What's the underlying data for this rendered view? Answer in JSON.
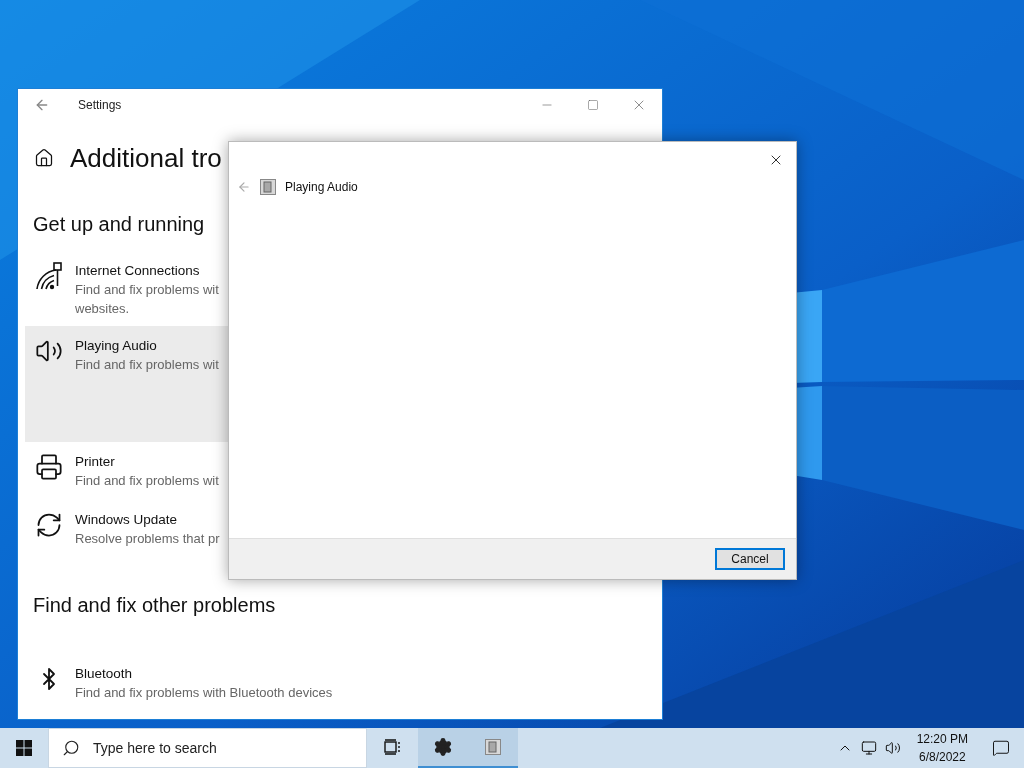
{
  "settings_window": {
    "title": "Settings",
    "heading": "Additional tro",
    "sections": [
      {
        "title": "Get up and running",
        "items": [
          {
            "kind": "internet",
            "name": "Internet Connections",
            "description_lines": [
              "Find and fix problems wit",
              "websites."
            ],
            "selected": false
          },
          {
            "kind": "audio",
            "name": "Playing Audio",
            "description_lines": [
              "Find and fix problems wit"
            ],
            "selected": true
          },
          {
            "kind": "printer",
            "name": "Printer",
            "description_lines": [
              "Find and fix problems wit"
            ],
            "selected": false
          },
          {
            "kind": "update",
            "name": "Windows Update",
            "description_lines": [
              "Resolve problems that pr"
            ],
            "selected": false
          }
        ]
      },
      {
        "title": "Find and fix other problems",
        "items": [
          {
            "kind": "bluetooth",
            "name": "Bluetooth",
            "description_lines": [
              "Find and fix problems with Bluetooth devices"
            ],
            "selected": false
          }
        ]
      }
    ]
  },
  "dialog": {
    "title": "Playing Audio",
    "buttons": [
      {
        "label": "Cancel",
        "default": true
      }
    ]
  },
  "taskbar": {
    "search": {
      "placeholder": "Type here to search"
    },
    "apps": [
      {
        "kind": "task-view",
        "active": false
      },
      {
        "kind": "settings",
        "active": true
      },
      {
        "kind": "troubleshooter",
        "active": true
      }
    ],
    "clock": {
      "time": "12:20 PM",
      "date": "6/8/2022"
    }
  }
}
